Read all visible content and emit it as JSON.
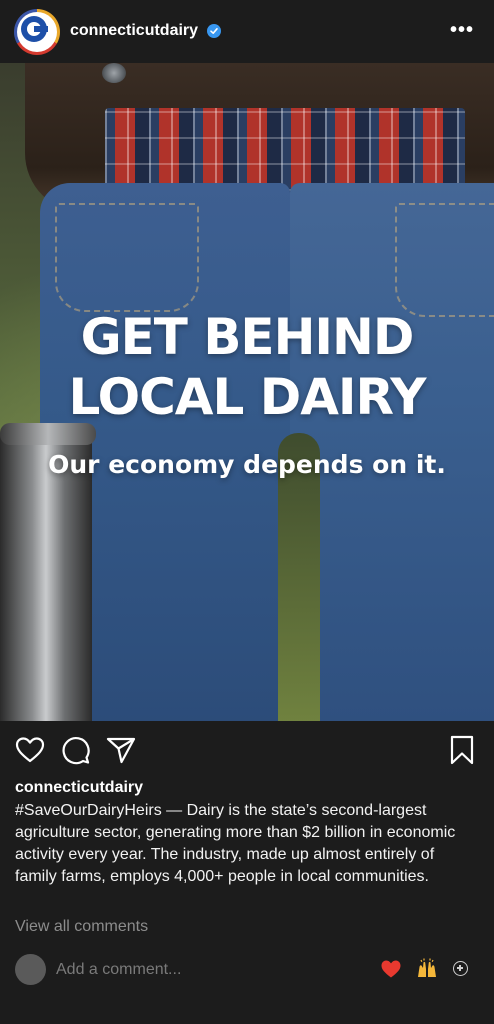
{
  "post": {
    "username": "connecticutdairy",
    "verified": true,
    "more_icon": "more-horizontal-icon",
    "image": {
      "headline_line1": "GET BEHIND",
      "headline_line2": "LOCAL DAIRY",
      "subhead": "Our economy depends on it."
    },
    "actions": {
      "like_icon": "heart-outline-icon",
      "comment_icon": "comment-bubble-icon",
      "share_icon": "paper-plane-icon",
      "save_icon": "bookmark-outline-icon"
    },
    "caption": {
      "username": "connecticutdairy",
      "text": "#SaveOurDairyHeirs — Dairy is the state’s second-largest agriculture sector, generating more than $2 billion in economic activity every year. The industry, made up almost entirely of family farms, employs 4,000+ people in local communities."
    },
    "view_comments": "View all comments",
    "comment_placeholder": "Add a comment...",
    "quick_reactions": [
      "❤️",
      "🙌"
    ],
    "colors": {
      "background": "#1c1c1c",
      "verified_blue": "#3897f0",
      "muted_text": "#8c8c8c"
    }
  }
}
